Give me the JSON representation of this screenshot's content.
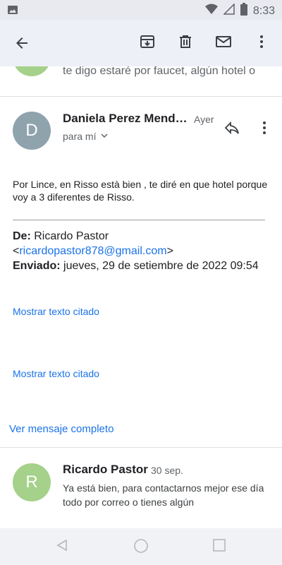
{
  "status_bar": {
    "time": "8:33"
  },
  "previous_message": {
    "snippet": "te digo estaré por faucet, algún hotel o"
  },
  "message": {
    "avatar_letter": "D",
    "avatar_color": "#8fa3ad",
    "sender": "Daniela Perez Mend…",
    "date": "Ayer",
    "to_line": "para mí",
    "body": "Por Lince, en Risso està bien , te diré en que hotel porque voy a 3 diferentes de Risso.",
    "quoted": {
      "from_label": "De:",
      "from_name": "Ricardo Pastor",
      "from_email": "ricardopastor878@gmail.com",
      "sent_label": "Enviado:",
      "sent_value": "jueves, 29 de setiembre de 2022 09:54"
    },
    "show_quoted_1": "Mostrar texto citado",
    "show_quoted_2": "Mostrar texto citado",
    "view_full": "Ver mensaje completo"
  },
  "next_message": {
    "avatar_letter": "R",
    "avatar_color": "#a5d18a",
    "sender": "Ricardo Pastor",
    "date": "30 sep.",
    "snippet": "Ya está bien, para contactarnos mejor ese día todo por correo o tienes algún"
  },
  "colors": {
    "accent": "#1a73e8",
    "appbar": "#eef0f7"
  },
  "icons": [
    "image-icon",
    "wifi-icon",
    "signal-icon",
    "battery-icon",
    "back-arrow-icon",
    "archive-icon",
    "delete-icon",
    "mark-unread-icon",
    "more-vert-icon",
    "reply-icon",
    "chevron-down-icon",
    "nav-back-icon",
    "nav-home-icon",
    "nav-recents-icon"
  ]
}
